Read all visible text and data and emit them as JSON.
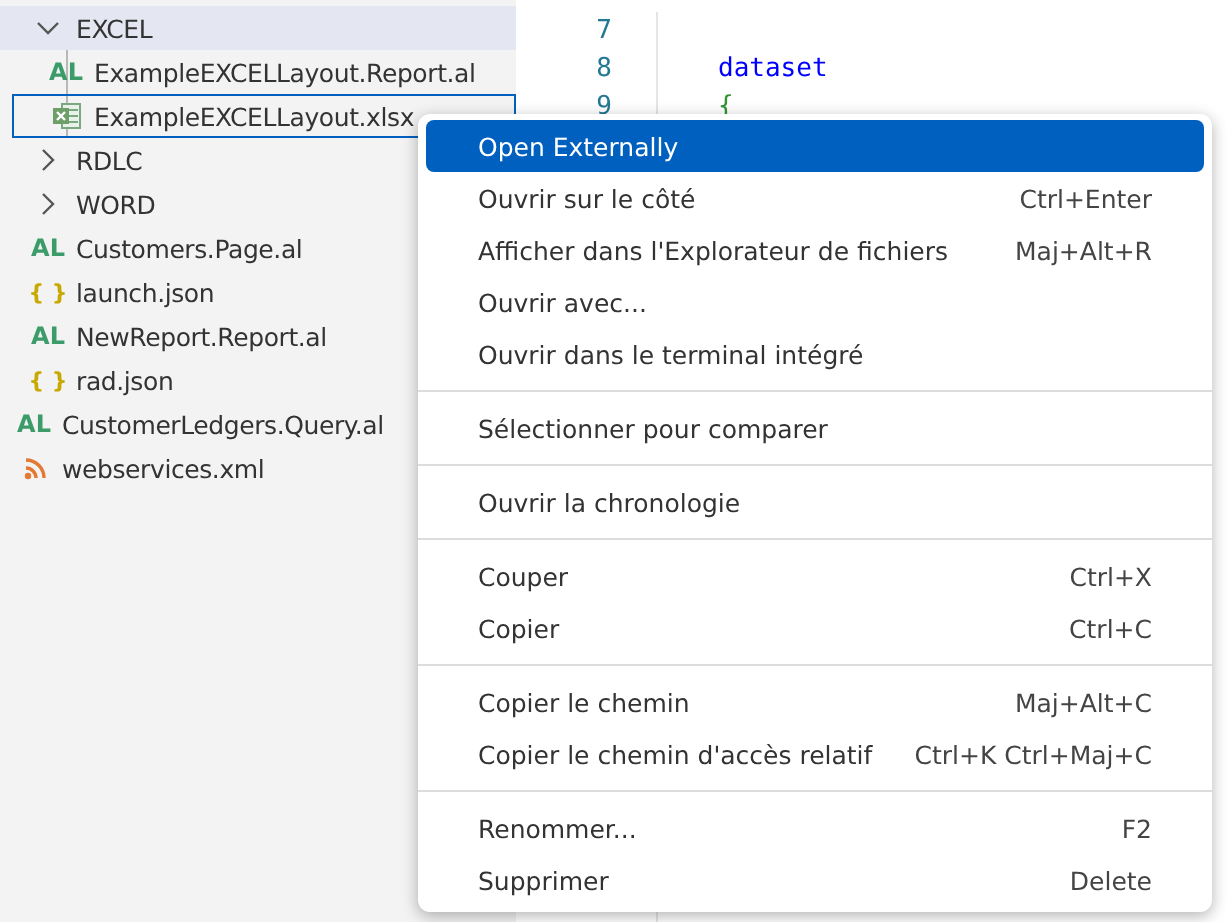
{
  "explorer": {
    "items": [
      {
        "kind": "group",
        "children": [
          {
            "kind": "folder",
            "label": "EXCEL",
            "expanded": true,
            "highlighted": true,
            "focused": false,
            "children": [
              {
                "kind": "al",
                "badge": "AL",
                "label": "ExampleEXCELLayout.Report.al",
                "highlighted": false,
                "focused": false
              },
              {
                "kind": "excel",
                "label": "ExampleEXCELLayout.xlsx",
                "highlighted": false,
                "focused": true
              }
            ]
          },
          {
            "kind": "folder",
            "label": "RDLC",
            "expanded": false,
            "highlighted": false,
            "focused": false
          },
          {
            "kind": "folder",
            "label": "WORD",
            "expanded": false,
            "highlighted": false,
            "focused": false
          },
          {
            "kind": "al",
            "badge": "AL",
            "label": "Customers.Page.al",
            "highlighted": false,
            "focused": false
          },
          {
            "kind": "json",
            "badge": "{ }",
            "label": "launch.json",
            "highlighted": false,
            "focused": false
          },
          {
            "kind": "al",
            "badge": "AL",
            "label": "NewReport.Report.al",
            "highlighted": false,
            "focused": false
          },
          {
            "kind": "json",
            "badge": "{ }",
            "label": "rad.json",
            "highlighted": false,
            "focused": false
          }
        ]
      },
      {
        "kind": "al",
        "badge": "AL",
        "label": "CustomerLedgers.Query.al",
        "highlighted": false,
        "focused": false
      },
      {
        "kind": "rss",
        "label": "webservices.xml",
        "highlighted": false,
        "focused": false
      }
    ]
  },
  "editor": {
    "lines": [
      {
        "number": "7"
      },
      {
        "number": "8",
        "code": "dataset"
      },
      {
        "number": "9",
        "code": "{"
      }
    ]
  },
  "context_menu": {
    "items": [
      {
        "kind": "item",
        "label": "Open Externally",
        "selected": true
      },
      {
        "kind": "item",
        "label": "Ouvrir sur le côté",
        "shortcut": "Ctrl+Enter",
        "selected": false
      },
      {
        "kind": "item",
        "label": "Afficher dans l'Explorateur de fichiers",
        "shortcut": "Maj+Alt+R",
        "selected": false
      },
      {
        "kind": "item",
        "label": "Ouvrir avec...",
        "selected": false
      },
      {
        "kind": "item",
        "label": "Ouvrir dans le terminal intégré",
        "selected": false
      },
      {
        "kind": "separator"
      },
      {
        "kind": "item",
        "label": "Sélectionner pour comparer",
        "selected": false
      },
      {
        "kind": "separator"
      },
      {
        "kind": "item",
        "label": "Ouvrir la chronologie",
        "selected": false
      },
      {
        "kind": "separator"
      },
      {
        "kind": "item",
        "label": "Couper",
        "shortcut": "Ctrl+X",
        "selected": false
      },
      {
        "kind": "item",
        "label": "Copier",
        "shortcut": "Ctrl+C",
        "selected": false
      },
      {
        "kind": "separator"
      },
      {
        "kind": "item",
        "label": "Copier le chemin",
        "shortcut": "Maj+Alt+C",
        "selected": false
      },
      {
        "kind": "item",
        "label": "Copier le chemin d'accès relatif",
        "shortcut": "Ctrl+K Ctrl+Maj+C",
        "selected": false
      },
      {
        "kind": "separator"
      },
      {
        "kind": "item",
        "label": "Renommer...",
        "shortcut": "F2",
        "selected": false
      },
      {
        "kind": "item",
        "label": "Supprimer",
        "shortcut": "Delete",
        "selected": false
      }
    ]
  }
}
